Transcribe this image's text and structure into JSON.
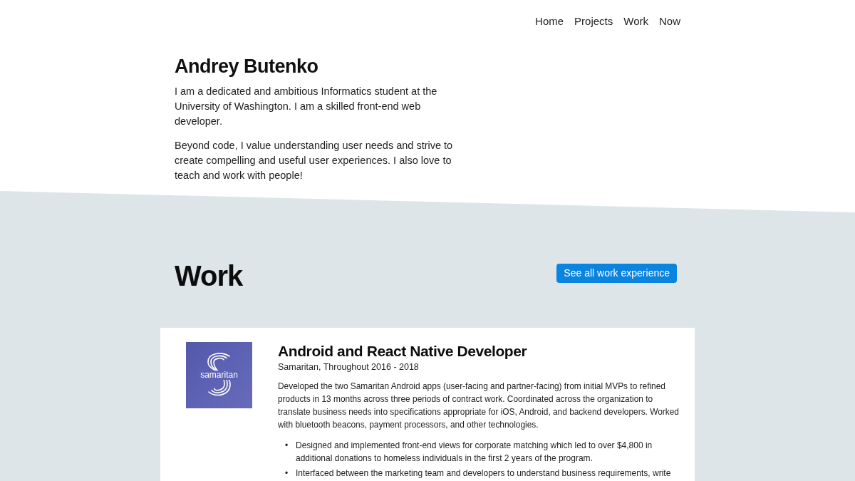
{
  "nav": {
    "links": [
      "Home",
      "Projects",
      "Work",
      "Now"
    ]
  },
  "intro": {
    "name": "Andrey Butenko",
    "paragraphs": [
      "I am a dedicated and ambitious Informatics student at the University of Washington. I am a skilled front-end web developer.",
      "Beyond code, I value understanding user needs and strive to create compelling and useful user experiences. I also love to teach and work with people!"
    ]
  },
  "work": {
    "heading": "Work",
    "button": "See all work experience",
    "jobs": [
      {
        "logo_text": "samaritan",
        "title": "Android and React Native Developer",
        "subtitle": "Samaritan, Throughout 2016 - 2018",
        "description": "Developed the two Samaritan Android apps (user-facing and partner-facing) from initial MVPs to refined products in 13 months across three periods of contract work. Coordinated across the organization to translate business needs into specifications appropriate for iOS, Android, and backend developers. Worked with bluetooth beacons, payment processors, and other technologies.",
        "bullets": [
          {
            "marker": "•",
            "text": "Designed and implemented front-end views for corporate matching which led to over $4,800 in additional donations to homeless individuals in the first 2 years of the program."
          },
          {
            "marker": "•",
            "text": "Interfaced between the marketing team and developers to understand business requirements, write"
          }
        ]
      }
    ]
  }
}
